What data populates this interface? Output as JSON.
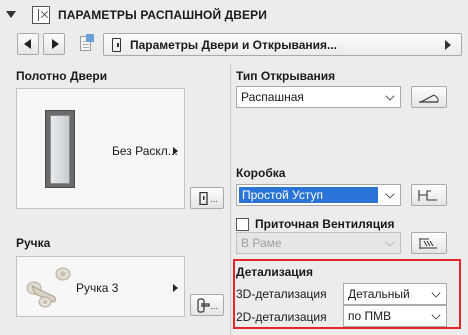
{
  "header": {
    "title": "ПАРАМЕТРЫ РАСПАШНОЙ ДВЕРИ"
  },
  "toolbar": {
    "page_selector": "Параметры Двери и Открывания..."
  },
  "door_panel": {
    "label": "Полотно Двери",
    "preview_text": "Без Раскл..."
  },
  "handle": {
    "label": "Ручка",
    "preview_text": "Ручка 3"
  },
  "opening": {
    "label": "Тип Открывания",
    "value": "Распашная"
  },
  "frame": {
    "label": "Коробка",
    "value": "Простой Уступ"
  },
  "ventilation": {
    "label": "Приточная Вентиляция",
    "checked": false,
    "value": "В Раме"
  },
  "detail": {
    "label": "Детализация",
    "d3_label": "3D-детализация",
    "d3_value": "Детальный",
    "d2_label": "2D-детализация",
    "d2_value": "по ПМВ"
  },
  "colors": {
    "highlight": "#2b74d7",
    "detail_border": "#e5232b"
  }
}
